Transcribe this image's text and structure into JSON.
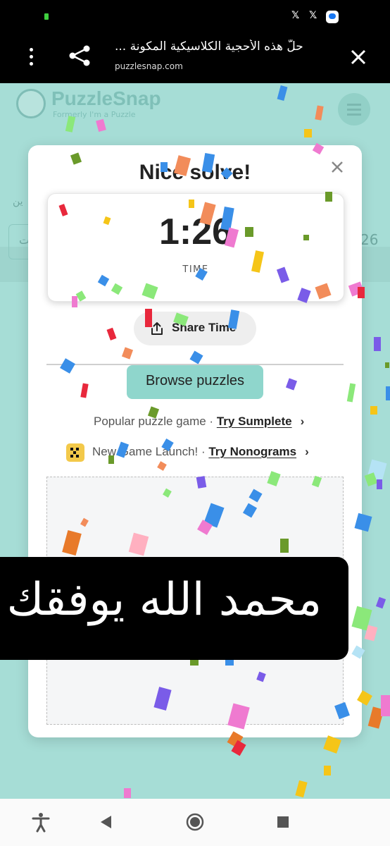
{
  "status_bar": {
    "icons": [
      "notification-dot",
      "x-icon",
      "x-icon",
      "messenger-icon"
    ],
    "x_glyph": "𝕏"
  },
  "toolbar": {
    "title": "حلّ هذه الأحجية الكلاسيكية المكونة ...",
    "url": "puzzlesnap.com",
    "icons": [
      "more-vertical-icon",
      "share-icon",
      "close-icon"
    ]
  },
  "page": {
    "logo": "PuzzleSnap",
    "logo_sub": "Formerly I'm a Puzzle",
    "frag_left": "ين",
    "frag_input": "ت",
    "frag_right": "26"
  },
  "modal": {
    "title": "Nice solve!",
    "time_value": "1:26",
    "time_label": "TIME",
    "share_label": "Share Time",
    "browse_label": "Browse puzzles",
    "promo1_text": "Popular puzzle game · ",
    "promo1_link": "Try Sumplete",
    "promo2_text": "New Game Launch! · ",
    "promo2_link": "Try Nonograms",
    "chevron": "›"
  },
  "banner": {
    "text": "محمد الله يوفقك"
  },
  "navbar": {
    "icons": [
      "accessibility-icon",
      "back-icon",
      "home-icon",
      "recents-icon"
    ]
  },
  "colors": {
    "page_bg": "#a6ddd6",
    "browse_bg": "#8fd6cc",
    "modal_bg": "#ffffff",
    "banner_bg": "#000000"
  }
}
